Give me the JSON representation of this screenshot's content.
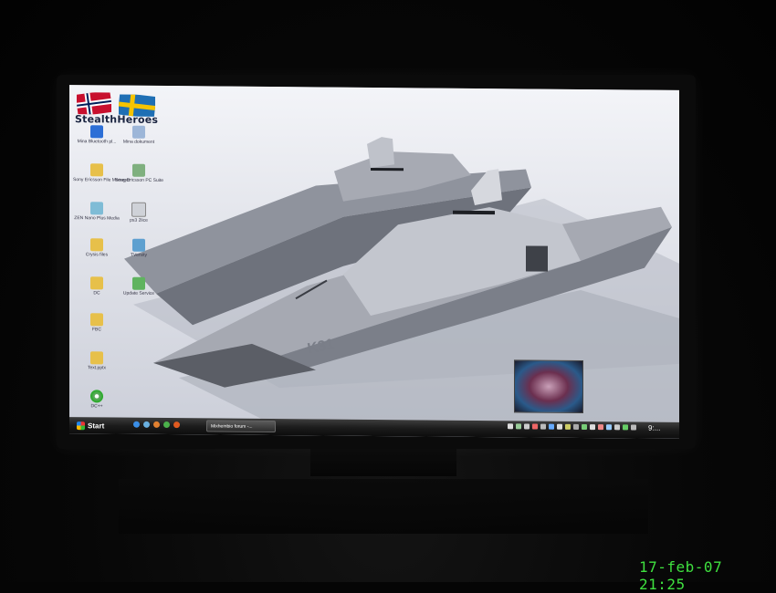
{
  "desktop": {
    "logo_text": "StealthHeroes",
    "icons": [
      {
        "name": "flag-icon-norway",
        "label": ""
      },
      {
        "name": "flag-icon-sweden",
        "label": ""
      },
      {
        "name": "bluetooth-icon",
        "label": "Mina Bluetooth pl..."
      },
      {
        "name": "computer-icon",
        "label": "Mina dokument"
      },
      {
        "name": "folder-icon",
        "label": "Sony Ericsson File Manager"
      },
      {
        "name": "phone-icon",
        "label": "Sony Ericsson PC Suite"
      },
      {
        "name": "media-icon",
        "label": "ZEN Nano Plus Media"
      },
      {
        "name": "program-icon",
        "label": "ps3 2lice"
      },
      {
        "name": "folder-icon-2",
        "label": "Crysis files"
      },
      {
        "name": "tv-icon",
        "label": "TVersity"
      },
      {
        "name": "folder-icon-3",
        "label": "DC"
      },
      {
        "name": "update-icon",
        "label": "Update Service"
      },
      {
        "name": "folder-icon-4",
        "label": "FBC"
      },
      {
        "name": "folder-icon-5",
        "label": "Text.pptx"
      },
      {
        "name": "disc-icon",
        "label": "DC++"
      }
    ]
  },
  "ship": {
    "hull_marking": "K31"
  },
  "taskbar": {
    "start_label": "Start",
    "task_label": "Mixhembio forum -...",
    "clock": "9:..."
  },
  "camera": {
    "timestamp": "17-feb-07 21:25"
  },
  "colors": {
    "stamp": "#3fe03f",
    "taskbar": "#1c1c1c",
    "hull": "#9a9ea8"
  }
}
